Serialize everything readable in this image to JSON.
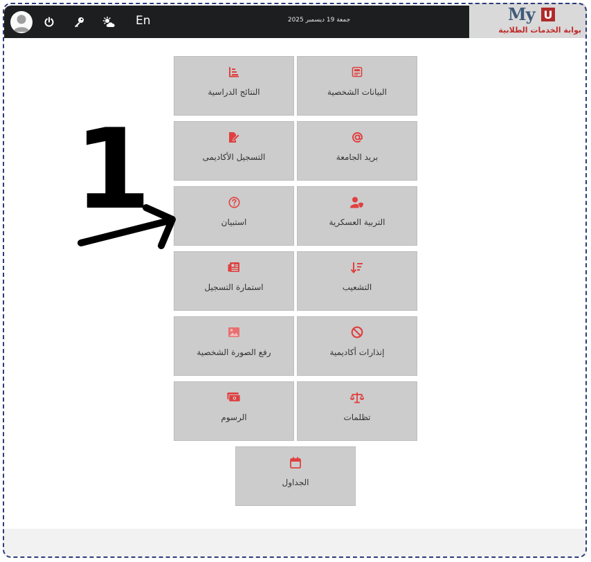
{
  "header": {
    "language_toggle": "En",
    "date": "جمعة 19 ديسمبر 2025",
    "logo": {
      "my": "My",
      "u": "U",
      "subtitle": "بوابة الخدمات الطلابية"
    }
  },
  "tiles": {
    "personal_data": "البيانات الشخصية",
    "study_results": "النتائج الدراسية",
    "university_mail": "بريد الجامعة",
    "academic_registration": "التسجيل الأكاديمى",
    "military_education": "التربية العسكرية",
    "questionnaire": "استبيان",
    "specialization": "التشعيب",
    "registration_form": "استمارة التسجيل",
    "academic_warnings": "إنذارات أكاديمية",
    "upload_photo": "رفع الصورة الشخصية",
    "grievances": "تظلمات",
    "fees": "الرسوم",
    "schedules": "الجداول"
  },
  "annotation": {
    "number": "1"
  },
  "colors": {
    "accent": "#e04040",
    "topbar": "#1d1e20",
    "tile": "#cccccc"
  }
}
